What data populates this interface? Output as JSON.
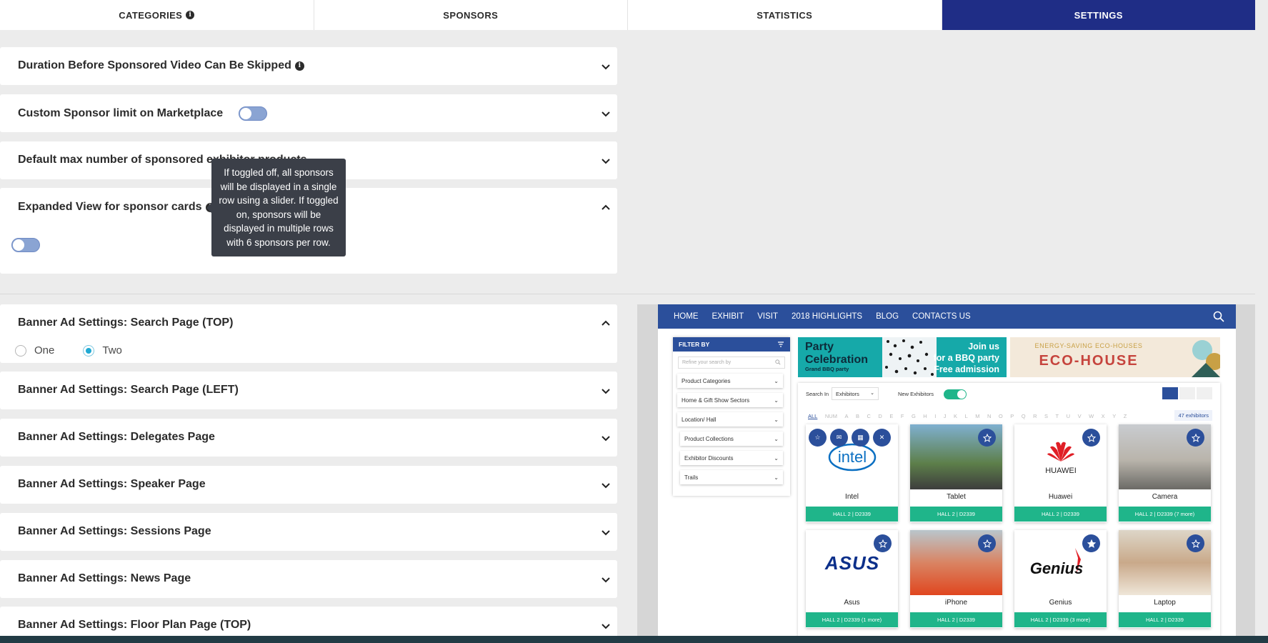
{
  "tabs": [
    {
      "label": "CATEGORIES",
      "active": false,
      "has_info": true
    },
    {
      "label": "SPONSORS",
      "active": false
    },
    {
      "label": "STATISTICS",
      "active": false
    },
    {
      "label": "SETTINGS",
      "active": true
    }
  ],
  "settings": [
    {
      "title": "Duration Before Sponsored Video Can Be Skipped",
      "expanded": false
    },
    {
      "title": "Custom Sponsor limit on Marketplace",
      "expanded": false,
      "toggle": false
    },
    {
      "title": "Default max number of sponsored exhibitor products",
      "expanded": false
    },
    {
      "title": "Expanded View for sponsor cards",
      "expanded": true,
      "toggle": false
    }
  ],
  "tooltip": {
    "text": "If toggled off, all sponsors will be displayed in a single row using a slider. If toggled on, sponsors will be displayed in multiple rows with 6 sponsors per row."
  },
  "banner_settings": [
    {
      "title": "Banner Ad Settings: Search Page (TOP)",
      "expanded": true
    },
    {
      "title": "Banner Ad Settings: Search Page (LEFT)",
      "expanded": false
    },
    {
      "title": "Banner Ad Settings: Delegates Page",
      "expanded": false
    },
    {
      "title": "Banner Ad Settings: Speaker Page",
      "expanded": false
    },
    {
      "title": "Banner Ad Settings: Sessions Page",
      "expanded": false
    },
    {
      "title": "Banner Ad Settings: News Page",
      "expanded": false
    },
    {
      "title": "Banner Ad Settings: Floor Plan Page (TOP)",
      "expanded": false
    }
  ],
  "radio": {
    "options": [
      "One",
      "Two"
    ],
    "selected": "Two"
  },
  "preview": {
    "nav": [
      "HOME",
      "EXHIBIT",
      "VISIT",
      "2018 HIGHLIGHTS",
      "BLOG",
      "CONTACTS US"
    ],
    "filter_title": "FILTER BY",
    "filter_placeholder": "Refine your search by",
    "filter_items": [
      "Product Categories",
      "Home & Gift Show Sectors",
      "Location/ Hall",
      "Product Collections",
      "Exhibitor Discounts",
      "Trails"
    ],
    "banner1": {
      "title_line1": "Party",
      "title_line2": "Celebration",
      "subtitle": "Grand BBQ party",
      "right_line1": "Join us",
      "right_line2": "for a BBQ party",
      "right_line3": "Free admission"
    },
    "banner2": {
      "top": "ENERGY-SAVING ECO-HOUSES",
      "title": "ECO-HOUSE"
    },
    "search_in_label": "Search In",
    "search_in_value": "Exhibitors",
    "new_exhibitors_label": "New Exhibitors",
    "alphabet": [
      "ALL",
      "NUM",
      "A",
      "B",
      "C",
      "D",
      "E",
      "F",
      "G",
      "H",
      "I",
      "J",
      "K",
      "L",
      "M",
      "N",
      "O",
      "P",
      "Q",
      "R",
      "S",
      "T",
      "U",
      "V",
      "W",
      "X",
      "Y",
      "Z"
    ],
    "count": "47 exhibitors",
    "products": [
      {
        "name": "Intel",
        "hall": "HALL 2 | D2339",
        "logo": "intel"
      },
      {
        "name": "Tablet",
        "hall": "HALL 2 | D2339",
        "logo": "photo"
      },
      {
        "name": "Huawei",
        "hall": "HALL 2 | D2339",
        "logo": "HUAWEI"
      },
      {
        "name": "Camera",
        "hall": "HALL 2 | D2339 (7 more)",
        "logo": "photo"
      },
      {
        "name": "Asus",
        "hall": "HALL 2 | D2339 (1 more)",
        "logo": "ASUS"
      },
      {
        "name": "iPhone",
        "hall": "HALL 2 | D2339",
        "logo": "photo"
      },
      {
        "name": "Genius",
        "hall": "HALL 2 | D2339 (3 more)",
        "logo": "Genius"
      },
      {
        "name": "Laptop",
        "hall": "HALL 2 | D2339",
        "logo": "photo"
      }
    ]
  },
  "colors": {
    "accent": "#1f2d86",
    "toggle_off": "#8aa4d3",
    "green": "#1fb58a",
    "preview_blue": "#2b4f9b"
  }
}
